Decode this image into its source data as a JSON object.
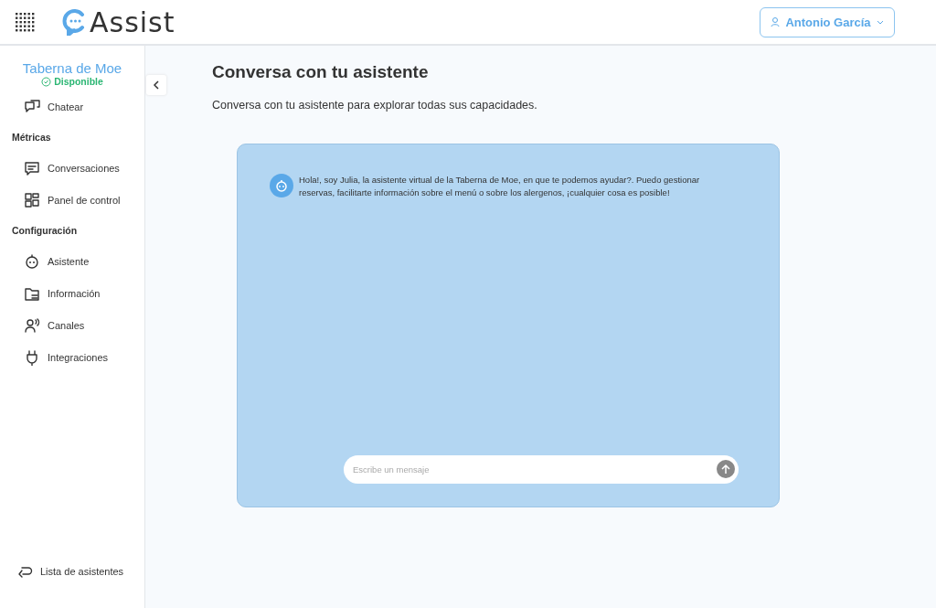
{
  "header": {
    "logo": "Assist",
    "user": "Antonio García"
  },
  "sidebar": {
    "business": "Taberna de Moe",
    "status": "Disponible",
    "items": [
      {
        "kind": "item",
        "label": "Chatear"
      },
      {
        "kind": "section",
        "label": "Métricas"
      },
      {
        "kind": "item",
        "label": "Conversaciones"
      },
      {
        "kind": "item",
        "label": "Panel de control"
      },
      {
        "kind": "section",
        "label": "Configuración"
      },
      {
        "kind": "item",
        "label": "Asistente"
      },
      {
        "kind": "item",
        "label": "Información"
      },
      {
        "kind": "item",
        "label": "Canales"
      },
      {
        "kind": "item",
        "label": "Integraciones"
      }
    ],
    "footer": "Lista de asistentes"
  },
  "main": {
    "title": "Conversa con tu asistente",
    "subtitle": "Conversa con tu asistente para explorar todas sus capacidades.",
    "chat": {
      "messages": [
        "Hola!, soy Julia, la asistente virtual de la Taberna de Moe, en que te podemos ayudar?. Puedo gestionar reservas, facilitarte información sobre el menú o sobre los alergenos, ¡cualquier cosa es posible!"
      ],
      "input": {
        "placeholder": "Escribe un mensaje"
      }
    }
  }
}
